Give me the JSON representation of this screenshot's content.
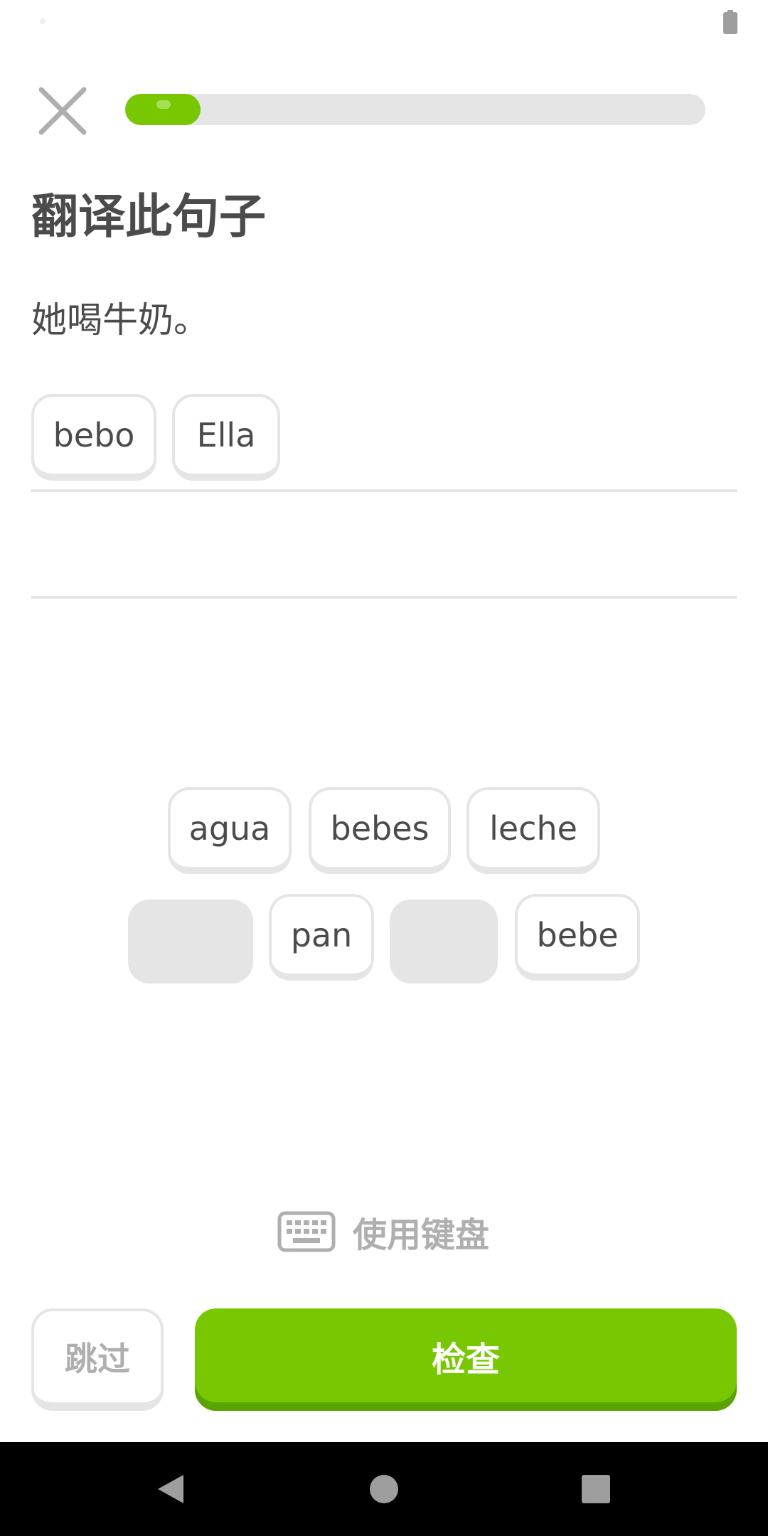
{
  "lesson": {
    "progress_fraction": 0.13,
    "title": "翻译此句子",
    "prompt": "她喝牛奶。"
  },
  "answer": {
    "selected_tiles": [
      "bebo",
      "Ella"
    ]
  },
  "word_bank": {
    "row1": [
      "agua",
      "bebes",
      "leche"
    ],
    "row2": [
      "pan",
      "bebe"
    ]
  },
  "footer": {
    "keyboard_label": "使用键盘",
    "skip_label": "跳过",
    "check_label": "检查"
  },
  "colors": {
    "accent": "#77c800",
    "accent_shadow": "#5aa300",
    "text": "#4b4b4b",
    "muted": "#afafaf",
    "border": "#e5e5e5"
  },
  "icons": {
    "close": "close-icon",
    "keyboard": "keyboard-icon",
    "battery": "battery-icon",
    "nav_back": "back-triangle-icon",
    "nav_home": "home-circle-icon",
    "nav_recents": "recents-square-icon"
  }
}
